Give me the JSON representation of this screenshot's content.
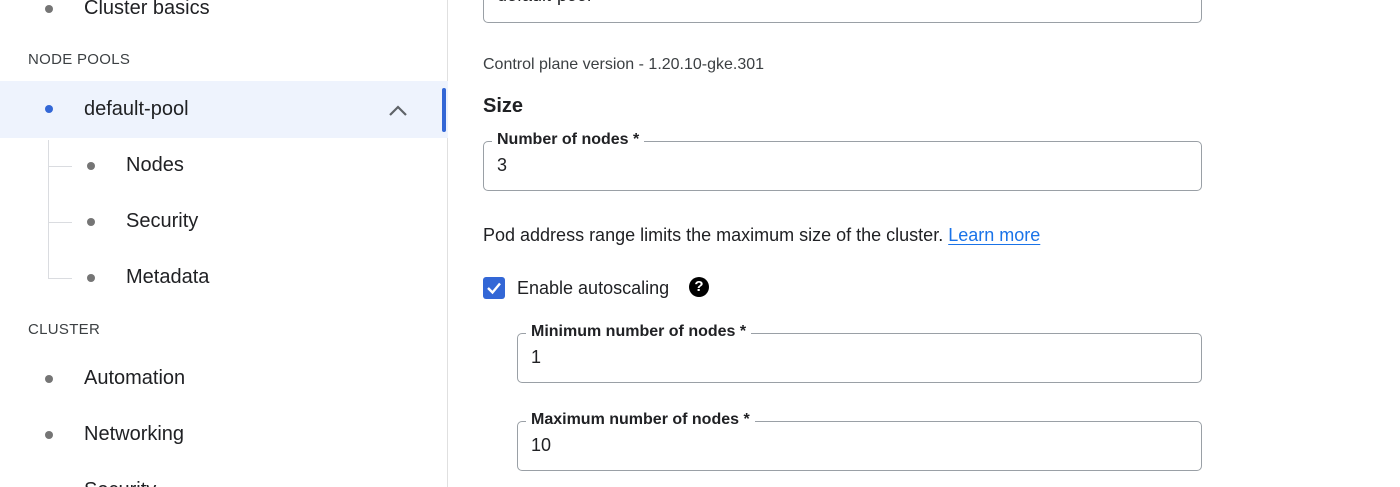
{
  "sidebar": {
    "top_item": "Cluster basics",
    "section_node_pools": "NODE POOLS",
    "pool": {
      "label": "default-pool",
      "expanded": true
    },
    "pool_children": [
      "Nodes",
      "Security",
      "Metadata"
    ],
    "section_cluster": "CLUSTER",
    "cluster_items": [
      "Automation",
      "Networking",
      "Security"
    ]
  },
  "main": {
    "name_field_value": "default-pool",
    "control_plane_text": "Control plane version - 1.20.10-gke.301",
    "size_heading": "Size",
    "num_nodes": {
      "label": "Number of nodes *",
      "value": "3"
    },
    "pod_range_text": "Pod address range limits the maximum size of the cluster.",
    "learn_more": "Learn more",
    "autoscaling": {
      "label": "Enable autoscaling",
      "checked": true
    },
    "min_nodes": {
      "label": "Minimum number of nodes *",
      "value": "1"
    },
    "max_nodes": {
      "label": "Maximum number of nodes *",
      "value": "10"
    }
  },
  "colors": {
    "accent": "#3367d6",
    "active_bg": "#eef3fd",
    "link": "#1a73e8"
  }
}
